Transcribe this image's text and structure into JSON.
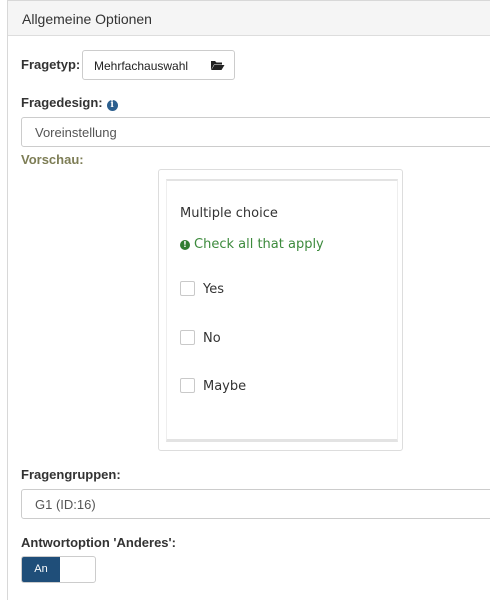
{
  "panel": {
    "title": "Allgemeine Optionen"
  },
  "question_type": {
    "label": "Fragetyp:",
    "value": "Mehrfachauswahl",
    "icon": "folder-open-icon"
  },
  "question_design": {
    "label": "Fragedesign:",
    "value": "Voreinstellung",
    "icon": "info-icon"
  },
  "preview": {
    "label": "Vorschau:",
    "question_title": "Multiple choice",
    "help_text": "Check all that apply",
    "options": [
      "Yes",
      "No",
      "Maybe"
    ]
  },
  "question_groups": {
    "label": "Fragengruppen:",
    "value": "G1 (ID:16)"
  },
  "other_option": {
    "label": "Antwortoption 'Anderes':",
    "toggle_on_label": "An",
    "value": true
  },
  "colors": {
    "accent": "#1f4e79",
    "help_green": "#3c8a3c",
    "preview_label": "#7d7d55"
  }
}
